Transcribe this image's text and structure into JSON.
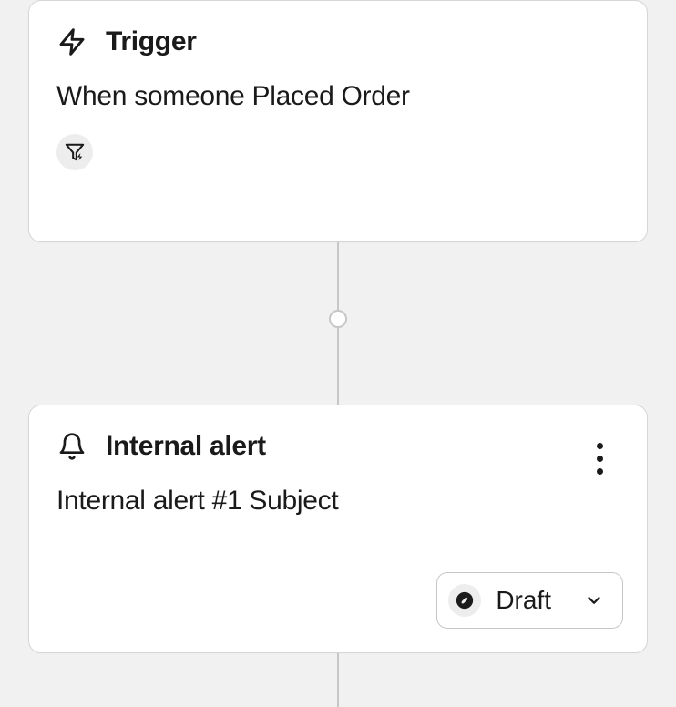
{
  "trigger": {
    "title": "Trigger",
    "description": "When someone Placed Order"
  },
  "alert": {
    "title": "Internal alert",
    "subject": "Internal alert #1 Subject",
    "status": "Draft"
  }
}
